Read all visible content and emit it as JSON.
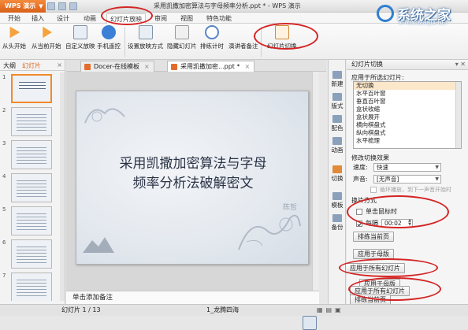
{
  "app": {
    "menu_button": "WPS 演示",
    "document_title": "采用凯撒加密算法与字母频率分析.ppt * - WPS 演示"
  },
  "menu_tabs": [
    "开始",
    "插入",
    "设计",
    "动画",
    "幻灯片放映",
    "审阅",
    "视图",
    "特色功能"
  ],
  "ribbon": {
    "from_start": "从头开始",
    "from_current": "从当前开始",
    "custom_show": "自定义放映",
    "phone_remote": "手机遥控",
    "setup_show": "设置放映方式",
    "hide_slide": "隐藏幻灯片",
    "rehearse": "排练计时",
    "presenter_notes": "演讲者备注",
    "slide_transition": "幻灯片切换"
  },
  "left_pane": {
    "tab_outline": "大纲",
    "tab_slides": "幻灯片",
    "close": "×",
    "thumbnails": [
      {
        "num": "1"
      },
      {
        "num": "2"
      },
      {
        "num": "3"
      },
      {
        "num": "4"
      },
      {
        "num": "5"
      },
      {
        "num": "6"
      },
      {
        "num": "7"
      }
    ]
  },
  "doc_tabs": {
    "tab1": "Docer-在线模板",
    "tab2": "采用凯撒加密...ppt *"
  },
  "slide": {
    "title_line1": "采用凯撒加密算法与字母",
    "title_line2": "频率分析法破解密文",
    "signature": "陈哲"
  },
  "notes_placeholder": "单击添加备注",
  "sidebar": [
    "新建",
    "版式",
    "配色",
    "动画",
    "切换",
    "模板",
    "备份"
  ],
  "task_pane": {
    "title": "幻灯片切换",
    "apply_label": "应用于所选幻灯片:",
    "transitions": [
      "无切换",
      "水平百叶窗",
      "垂直百叶窗",
      "盒状收缩",
      "盒状展开",
      "横向棋盘式",
      "纵向棋盘式",
      "水平梳理"
    ],
    "modify_label": "修改切换效果",
    "speed_label": "速度:",
    "speed_value": "快速",
    "sound_label": "声音:",
    "sound_value": "[无声音]",
    "loop_label": "循环播放，到下一声音开始时",
    "advance_label": "换片方式",
    "on_click_label": "单击鼠标时",
    "every_label": "每隔",
    "every_value": "00:02",
    "rehearse_btn": "排练当前页",
    "apply_master_btn": "应用于母版",
    "apply_all_btn": "应用于所有幻灯片",
    "overlay_master": "应用于母版",
    "overlay_all": "应用于所有幻灯片",
    "overlay_rehearse": "排练当前页"
  },
  "status": {
    "slide_count": "幻灯片 1 / 13",
    "theme": "1_龙腾四海"
  },
  "watermark": {
    "text": "系统之家",
    "sub": "XITONGZHIJIA.NET"
  }
}
